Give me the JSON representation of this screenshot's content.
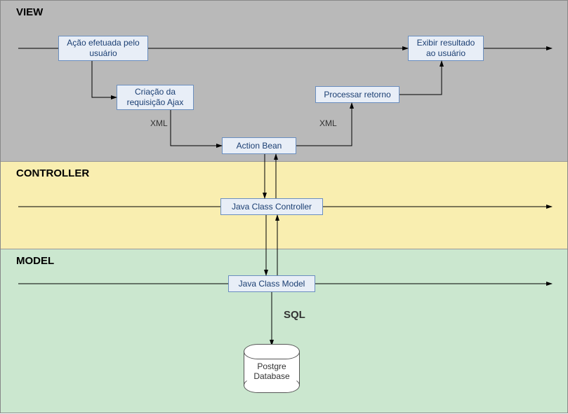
{
  "layers": {
    "view": "VIEW",
    "controller": "CONTROLLER",
    "model": "MODEL"
  },
  "nodes": {
    "user_action": "Ação efetuada pelo usuário",
    "ajax_request": "Criação da requisição Ajax",
    "action_bean": "Action Bean",
    "process_return": "Processar retorno",
    "show_result": "Exibir resultado ao usuário",
    "controller_class": "Java Class Controller",
    "model_class": "Java Class Model",
    "database": "Postgre\nDatabase"
  },
  "edge_labels": {
    "xml_down": "XML",
    "xml_up": "XML",
    "sql": "SQL"
  }
}
